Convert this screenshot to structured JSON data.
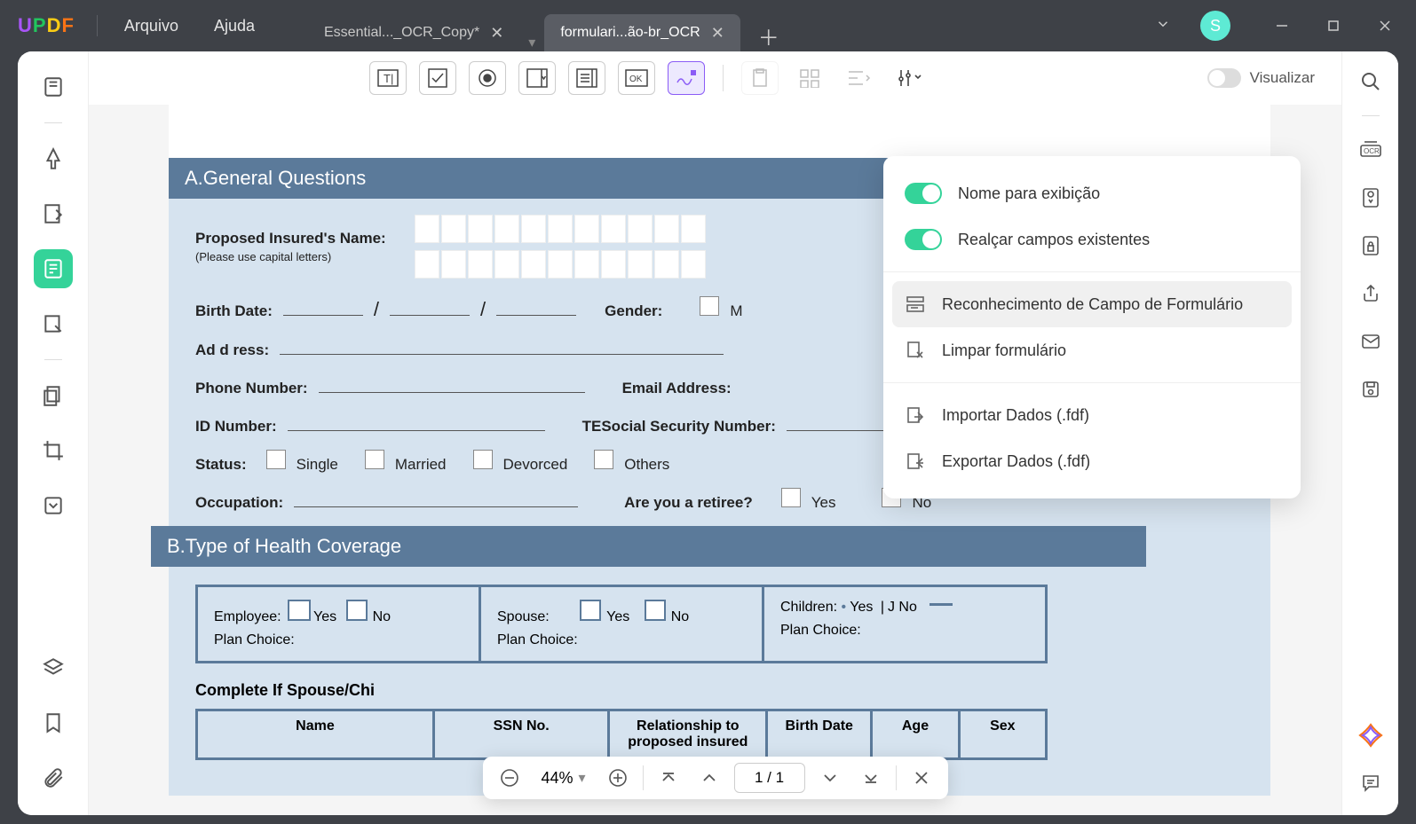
{
  "titlebar": {
    "menu": {
      "file": "Arquivo",
      "help": "Ajuda"
    },
    "tabs": [
      {
        "label": "Essential..._OCR_Copy*"
      },
      {
        "label": "formulari...ão-br_OCR"
      }
    ],
    "avatar": "S"
  },
  "toolbar": {
    "visualize_label": "Visualizar"
  },
  "dropdown": {
    "display_name": "Nome para exibição",
    "highlight_fields": "Realçar campos existentes",
    "recognize_form": "Reconhecimento de Campo de Formulário",
    "clear_form": "Limpar formulário",
    "import_data": "Importar Dados (.fdf)",
    "export_data": "Exportar Dados (.fdf)"
  },
  "document": {
    "section_a_title": "A.General Questions",
    "proposed_name_label": "Proposed Insured's Name:",
    "proposed_name_note": "(Please use capital letters)",
    "birth_date_label": "Birth Date:",
    "gender_label": "Gender:",
    "gender_m": "M",
    "address_label": "Ad d ress:",
    "phone_label": "Phone Number:",
    "email_label": "Email Address:",
    "id_label": "ID Number:",
    "ssn_label": "TESocial Security Number:",
    "status_label": "Status:",
    "status_single": "Single",
    "status_married": "Married",
    "status_divorced": "Devorced",
    "status_others": "Others",
    "occupation_label": "Occupation:",
    "retiree_q": "Are you a retiree?",
    "yes": "Yes",
    "no": "No",
    "section_b_title": "B.Type of Health Coverage",
    "employee_label": "Employee:",
    "spouse_label": "Spouse:",
    "children_label": "Children:",
    "children_j_no": "J No",
    "plan_choice": "Plan Choice:",
    "complete_if": "Complete If Spouse/Chi",
    "col_name": "Name",
    "col_ssn": "SSN No.",
    "col_relationship": "Relationship to proposed insured",
    "col_birth_date": "Birth Date",
    "col_age": "Age",
    "col_sex": "Sex"
  },
  "pagebar": {
    "zoom": "44%",
    "page_display": "1  /  1"
  }
}
